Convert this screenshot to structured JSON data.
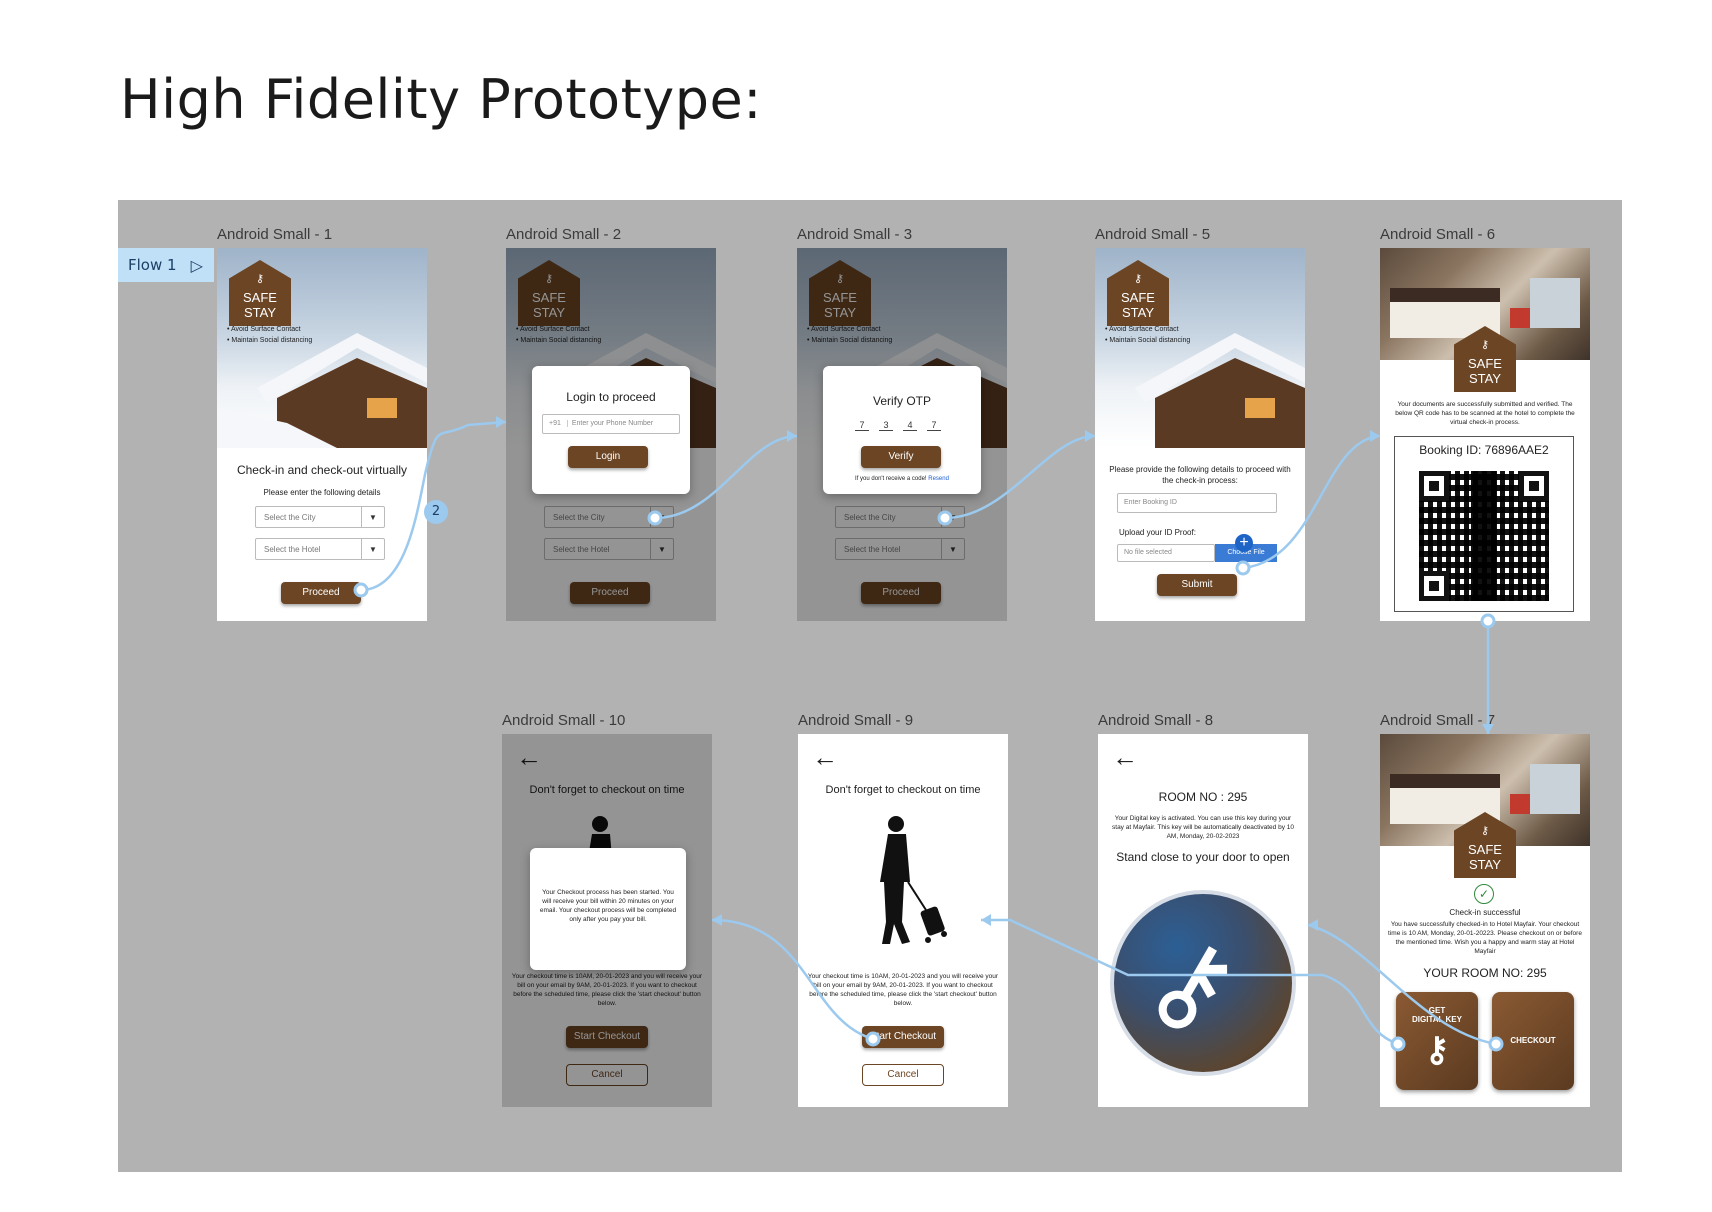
{
  "page_title": "High Fidelity Prototype:",
  "flow": {
    "label": "Flow 1",
    "step_badge": "2"
  },
  "brand": {
    "line1": "SAFE",
    "line2": "STAY"
  },
  "bullets": [
    "• Avoid Surface Contact",
    "• Maintain Social distancing"
  ],
  "frames": {
    "f1": {
      "label": "Android Small - 1",
      "heading": "Check-in and check-out virtually",
      "sub": "Please enter the following details",
      "city_placeholder": "Select the City",
      "hotel_placeholder": "Select the Hotel",
      "proceed": "Proceed"
    },
    "f2": {
      "label": "Android Small - 2",
      "modal_title": "Login to proceed",
      "country_code": "+91",
      "phone_placeholder": "Enter your Phone Number",
      "login": "Login"
    },
    "f3": {
      "label": "Android Small - 3",
      "modal_title": "Verify OTP",
      "otp": [
        "7",
        "3",
        "4",
        "7"
      ],
      "verify": "Verify",
      "resend_text": "If you don't receive a code!",
      "resend_link": "Resend"
    },
    "f5": {
      "label": "Android Small - 5",
      "instructions": "Please provide the following details to proceed with the check-in process:",
      "booking_placeholder": "Enter Booking ID",
      "upload_label": "Upload your ID Proof:",
      "no_file": "No file selected",
      "choose_file": "Choose File",
      "submit": "Submit"
    },
    "f6": {
      "label": "Android Small - 6",
      "message": "Your documents are successfully submitted and verified. The below QR code has to be scanned at the hotel to complete the virtual check-in process.",
      "booking_id": "Booking ID: 76896AAE2"
    },
    "f7": {
      "label": "Android Small - 7",
      "status": "Check-in successful",
      "message": "You have successfully checked-in to Hotel Mayfair. Your checkout time is 10 AM, Monday, 20-01-20223. Please checkout on or before the mentioned time. Wish you a happy and warm stay at Hotel Mayfair",
      "room": "YOUR ROOM NO: 295",
      "digital_key_line1": "GET",
      "digital_key_line2": "DIGITAL KEY",
      "checkout": "CHECKOUT"
    },
    "f8": {
      "label": "Android Small - 8",
      "room": "ROOM NO : 295",
      "message": "Your Digital key is activated. You can use this key during your stay at Mayfair. This key will be automatically deactivated by 10 AM, Monday, 20-02-2023",
      "instruction": "Stand close to your door to open"
    },
    "f9": {
      "label": "Android Small - 9",
      "heading": "Don't forget to checkout on time",
      "message": "Your checkout time is 10AM, 20-01-2023 and you will receive your bill on your email by 9AM, 20-01-2023. If you want to checkout before the scheduled time, please click the 'start checkout' button below.",
      "start": "Start Checkout",
      "cancel": "Cancel"
    },
    "f10": {
      "label": "Android Small - 10",
      "heading": "Don't forget to checkout on time",
      "modal_message": "Your Checkout process has been started. You will receive your bill within 20 minutes on your email. Your checkout process will be completed only after you pay your bill.",
      "message": "Your checkout time is 10AM, 20-01-2023 and you will receive your bill on your email by 9AM, 20-01-2023. If you want to checkout before the scheduled time, please click the 'start checkout' button below.",
      "start": "Start Checkout",
      "cancel": "Cancel"
    }
  },
  "colors": {
    "brown": "#6b4524",
    "canvas": "#b2b2b2",
    "wire": "#9cc9ee",
    "flow_tag": "#bfe0f7"
  }
}
